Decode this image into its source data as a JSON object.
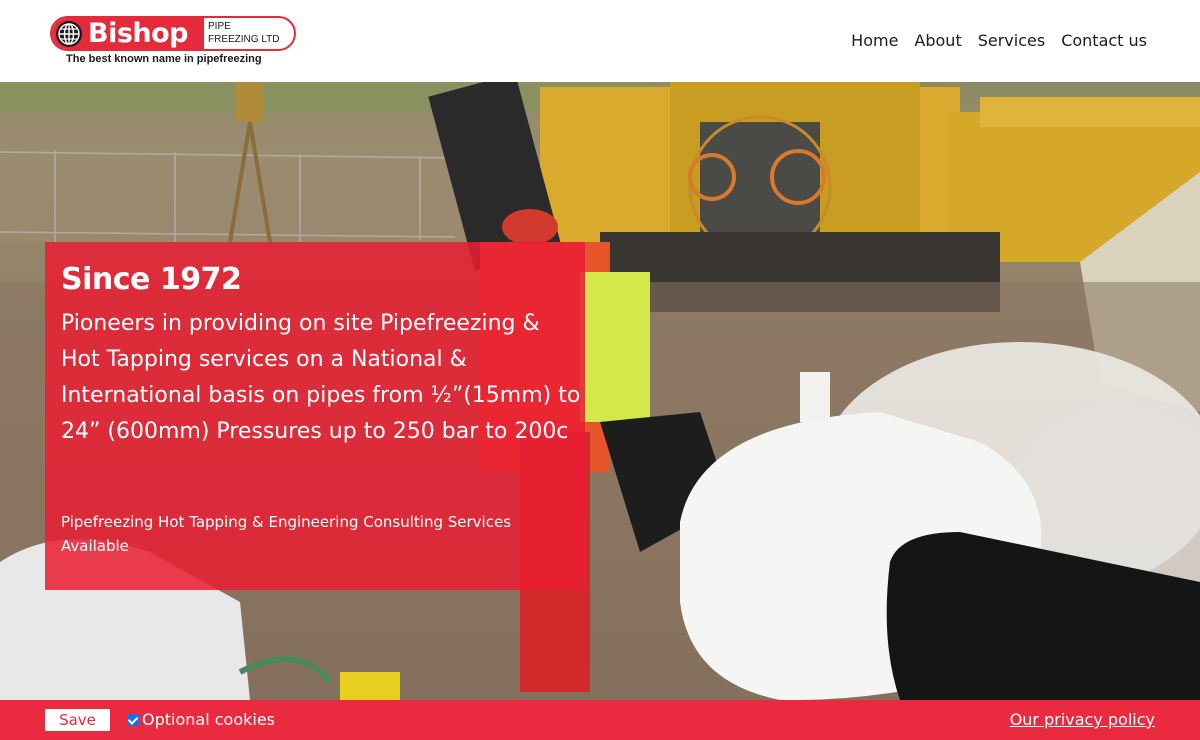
{
  "brand": {
    "name": "Bishop",
    "sub_line1": "PIPE",
    "sub_line2": "FREEZING LTD",
    "tagline": "The best known name in pipefreezing",
    "accent": "#e52a3b"
  },
  "nav": {
    "items": [
      {
        "label": "Home"
      },
      {
        "label": "About"
      },
      {
        "label": "Services"
      },
      {
        "label": "Contact us"
      }
    ]
  },
  "hero": {
    "title": "Since 1972",
    "body": "Pioneers in providing on site Pipefreezing & Hot Tapping services on a National & International basis on pipes from ½”(15mm) to 24” (600mm) Pressures up to 250 bar to 200c",
    "services": "Pipefreezing Hot Tapping & Engineering Consulting Services Available",
    "overlay_color": "#e91e32"
  },
  "cookie_bar": {
    "save_label": "Save",
    "optional_label": "Optional cookies",
    "optional_checked": true,
    "privacy_label": "Our privacy policy",
    "color": "#ea2a3e"
  },
  "icons": {
    "logo": "globe-icon",
    "checkbox": "checkbox-checked-icon"
  }
}
